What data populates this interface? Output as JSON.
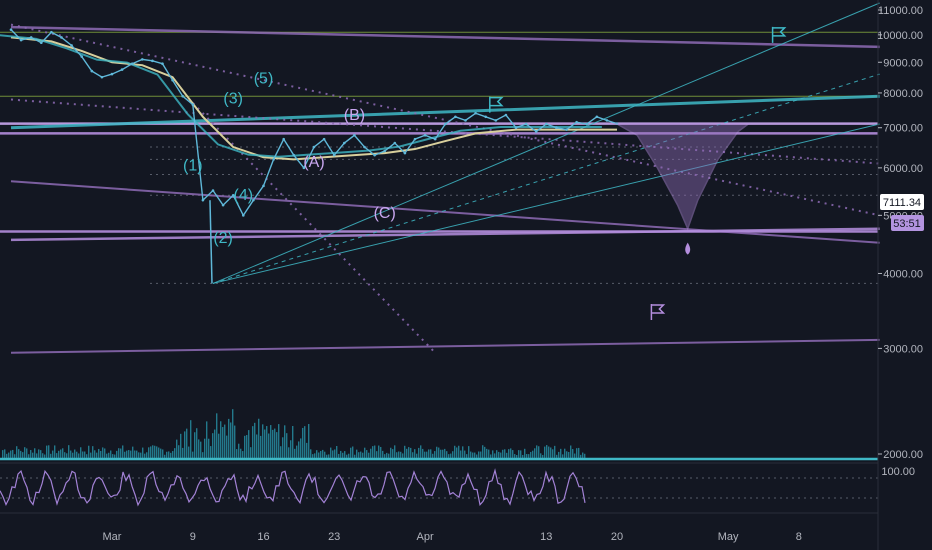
{
  "colors": {
    "background": "#131722",
    "axis_text": "#b2b5be",
    "teal": "#3fb8c6",
    "purple": "#8e6bb5",
    "purple_light": "#b48ede",
    "lavender": "#c9a7f0",
    "ma_beige": "#d8cf9c",
    "candle": "#5fb8d9",
    "volume": "#2a9bb0",
    "osc": "#a382d6",
    "price_badge_bg": "#ffffff",
    "price_badge_text": "#131722",
    "timer_badge_bg": "#b394e0",
    "timer_badge_text": "#131722",
    "hline_green": "#7a9a3c"
  },
  "badges": {
    "price": "7111.34",
    "timer": "53:51"
  },
  "oscillator": {
    "level_label": "100.00"
  },
  "wave_labels": [
    {
      "text": "(5)",
      "t": 15,
      "p": 8300
    },
    {
      "text": "(3)",
      "t": 12,
      "p": 7680
    },
    {
      "text": "(1)",
      "t": 8,
      "p": 5940
    },
    {
      "text": "(4)",
      "t": 13,
      "p": 5300
    },
    {
      "text": "(2)",
      "t": 11,
      "p": 4500
    },
    {
      "text": "(B)",
      "t": 24,
      "p": 7210
    },
    {
      "text": "(A)",
      "t": 20,
      "p": 6020
    },
    {
      "text": "(C)",
      "t": 27,
      "p": 4950
    }
  ],
  "chart_data": {
    "type": "candlestick",
    "title": "",
    "xlabel": "",
    "ylabel": "",
    "scale": "log",
    "ylim": [
      1700,
      11300
    ],
    "y_ticks": [
      {
        "v": 11000,
        "label": "11000.00"
      },
      {
        "v": 10000,
        "label": "10000.00"
      },
      {
        "v": 9000,
        "label": "9000.00"
      },
      {
        "v": 8000,
        "label": "8000.00"
      },
      {
        "v": 7000,
        "label": "7000.00"
      },
      {
        "v": 6000,
        "label": "6000.00"
      },
      {
        "v": 5000,
        "label": "5000.00"
      },
      {
        "v": 4000,
        "label": "4000.00"
      },
      {
        "v": 3000,
        "label": "3000.00"
      },
      {
        "v": 2000,
        "label": "2000.00"
      }
    ],
    "x_ticks": [
      {
        "t": 0,
        "label": "Mar"
      },
      {
        "t": 8,
        "label": "9"
      },
      {
        "t": 15,
        "label": "16"
      },
      {
        "t": 22,
        "label": "23"
      },
      {
        "t": 31,
        "label": "Apr"
      },
      {
        "t": 43,
        "label": "13"
      },
      {
        "t": 50,
        "label": "20"
      },
      {
        "t": 61,
        "label": "May"
      },
      {
        "t": 68,
        "label": "8"
      }
    ],
    "price_series": [
      {
        "t": -10,
        "p": 10200
      },
      {
        "t": -9,
        "p": 9800
      },
      {
        "t": -8,
        "p": 9900
      },
      {
        "t": -7,
        "p": 9700
      },
      {
        "t": -6,
        "p": 10100
      },
      {
        "t": -5,
        "p": 9900
      },
      {
        "t": -4,
        "p": 9600
      },
      {
        "t": -3,
        "p": 9200
      },
      {
        "t": -2,
        "p": 8700
      },
      {
        "t": -1,
        "p": 8500
      },
      {
        "t": 0,
        "p": 8600
      },
      {
        "t": 1,
        "p": 8750
      },
      {
        "t": 2,
        "p": 8950
      },
      {
        "t": 3,
        "p": 9100
      },
      {
        "t": 4,
        "p": 9050
      },
      {
        "t": 5,
        "p": 8950
      },
      {
        "t": 6,
        "p": 8400
      },
      {
        "t": 7,
        "p": 7900
      },
      {
        "t": 8,
        "p": 7650
      },
      {
        "t": 9,
        "p": 5300
      },
      {
        "t": 10,
        "p": 5500
      },
      {
        "t": 11,
        "p": 5200
      },
      {
        "t": 12,
        "p": 5400
      },
      {
        "t": 13,
        "p": 5000
      },
      {
        "t": 14,
        "p": 5300
      },
      {
        "t": 15,
        "p": 5600
      },
      {
        "t": 16,
        "p": 6200
      },
      {
        "t": 17,
        "p": 6700
      },
      {
        "t": 18,
        "p": 6300
      },
      {
        "t": 19,
        "p": 6000
      },
      {
        "t": 20,
        "p": 6500
      },
      {
        "t": 21,
        "p": 6700
      },
      {
        "t": 22,
        "p": 6300
      },
      {
        "t": 23,
        "p": 6600
      },
      {
        "t": 24,
        "p": 6800
      },
      {
        "t": 25,
        "p": 6500
      },
      {
        "t": 26,
        "p": 6300
      },
      {
        "t": 27,
        "p": 6400
      },
      {
        "t": 28,
        "p": 6600
      },
      {
        "t": 29,
        "p": 6350
      },
      {
        "t": 30,
        "p": 6700
      },
      {
        "t": 31,
        "p": 6800
      },
      {
        "t": 32,
        "p": 6700
      },
      {
        "t": 33,
        "p": 7100
      },
      {
        "t": 34,
        "p": 7300
      },
      {
        "t": 35,
        "p": 7200
      },
      {
        "t": 36,
        "p": 7400
      },
      {
        "t": 37,
        "p": 7300
      },
      {
        "t": 38,
        "p": 7200
      },
      {
        "t": 39,
        "p": 7350
      },
      {
        "t": 40,
        "p": 7000
      },
      {
        "t": 41,
        "p": 7100
      },
      {
        "t": 42,
        "p": 6900
      },
      {
        "t": 43,
        "p": 7100
      },
      {
        "t": 44,
        "p": 7000
      },
      {
        "t": 45,
        "p": 6950
      },
      {
        "t": 46,
        "p": 7150
      },
      {
        "t": 47,
        "p": 7100
      },
      {
        "t": 48,
        "p": 7300
      },
      {
        "t": 49,
        "p": 7200
      },
      {
        "t": 50,
        "p": 7111
      }
    ],
    "ma_series": [
      {
        "t": -10,
        "p": 9900
      },
      {
        "t": -6,
        "p": 9750
      },
      {
        "t": -3,
        "p": 9400
      },
      {
        "t": 0,
        "p": 9000
      },
      {
        "t": 3,
        "p": 8900
      },
      {
        "t": 6,
        "p": 8500
      },
      {
        "t": 9,
        "p": 7300
      },
      {
        "t": 12,
        "p": 6500
      },
      {
        "t": 15,
        "p": 6250
      },
      {
        "t": 18,
        "p": 6200
      },
      {
        "t": 21,
        "p": 6250
      },
      {
        "t": 24,
        "p": 6300
      },
      {
        "t": 27,
        "p": 6350
      },
      {
        "t": 30,
        "p": 6450
      },
      {
        "t": 33,
        "p": 6650
      },
      {
        "t": 36,
        "p": 6850
      },
      {
        "t": 40,
        "p": 6950
      },
      {
        "t": 45,
        "p": 6950
      },
      {
        "t": 50,
        "p": 6950
      }
    ],
    "projection_arc": [
      {
        "t": 50,
        "p": 7100
      },
      {
        "t": 52,
        "p": 6800
      },
      {
        "t": 54,
        "p": 6000
      },
      {
        "t": 56,
        "p": 5200
      },
      {
        "t": 57,
        "p": 4750
      },
      {
        "t": 58,
        "p": 5300
      },
      {
        "t": 60,
        "p": 6200
      },
      {
        "t": 62,
        "p": 6900
      },
      {
        "t": 63,
        "p": 7100
      }
    ],
    "horizontal_levels": [
      {
        "p": 7111,
        "style": "solid",
        "color_key": "lavender"
      },
      {
        "p": 6850,
        "style": "solid",
        "color_key": "purple_light"
      },
      {
        "p": 4700,
        "style": "solid",
        "color_key": "purple_light"
      },
      {
        "p": 10100,
        "style": "solid",
        "color_key": "hline_green"
      },
      {
        "p": 7900,
        "style": "solid",
        "color_key": "hline_green"
      }
    ],
    "trend_lines": [
      {
        "t1": -10,
        "p1": 10300,
        "t2": 76,
        "p2": 9550,
        "color_key": "purple",
        "style": "solid",
        "width": 2.5
      },
      {
        "t1": -10,
        "p1": 7000,
        "t2": 76,
        "p2": 7900,
        "color_key": "teal",
        "style": "solid",
        "width": 3
      },
      {
        "t1": -10,
        "p1": 5700,
        "t2": 76,
        "p2": 4500,
        "color_key": "purple",
        "style": "solid",
        "width": 2
      },
      {
        "t1": -10,
        "p1": 2950,
        "t2": 76,
        "p2": 3100,
        "color_key": "purple",
        "style": "solid",
        "width": 2
      },
      {
        "t1": -10,
        "p1": 4550,
        "t2": 76,
        "p2": 4750,
        "color_key": "purple_light",
        "style": "solid",
        "width": 2.5
      },
      {
        "t1": -10,
        "p1": 10400,
        "t2": 76,
        "p2": 5000,
        "color_key": "purple",
        "style": "dotted",
        "width": 2
      },
      {
        "t1": -10,
        "p1": 7800,
        "t2": 76,
        "p2": 6100,
        "color_key": "purple",
        "style": "dotted",
        "width": 2
      },
      {
        "t1": 10,
        "p1": 3850,
        "t2": 76,
        "p2": 11300,
        "color_key": "teal",
        "style": "solid",
        "width": 1
      },
      {
        "t1": 10,
        "p1": 3850,
        "t2": 76,
        "p2": 8600,
        "color_key": "teal",
        "style": "dashed",
        "width": 1
      },
      {
        "t1": 10,
        "p1": 3850,
        "t2": 76,
        "p2": 7100,
        "color_key": "teal",
        "style": "solid",
        "width": 1
      },
      {
        "t1": 8,
        "p1": 7700,
        "t2": 32,
        "p2": 2950,
        "color_key": "purple",
        "style": "dotted",
        "width": 2
      }
    ],
    "flags": [
      {
        "t": 66,
        "p": 10000,
        "color_key": "teal"
      },
      {
        "t": 38,
        "p": 7650,
        "color_key": "teal"
      },
      {
        "t": 54,
        "p": 3450,
        "color_key": "purple_light"
      }
    ],
    "droplet": {
      "t": 57,
      "p": 4350
    }
  }
}
